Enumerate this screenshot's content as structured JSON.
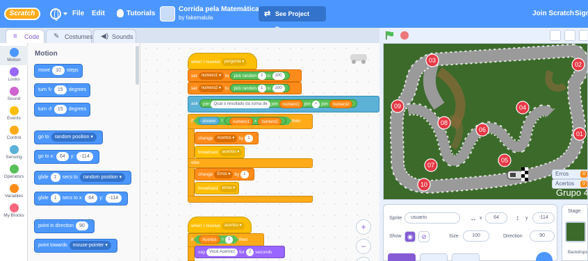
{
  "menubar": {
    "logo": "Scratch",
    "file": "File",
    "edit": "Edit",
    "tutorials": "Tutorials",
    "project_title": "Corrida pela Matemática",
    "project_author": "by fakemalula",
    "see_project": "See Project Page",
    "join": "Join Scratch",
    "sign_in": "Sign"
  },
  "tabs": {
    "code": "Code",
    "costumes": "Costumes",
    "sounds": "Sounds"
  },
  "categories": [
    {
      "label": "Motion",
      "color": "#4c97ff"
    },
    {
      "label": "Looks",
      "color": "#9966ff"
    },
    {
      "label": "Sound",
      "color": "#cf63cf"
    },
    {
      "label": "Events",
      "color": "#ffbf00"
    },
    {
      "label": "Control",
      "color": "#ffab19"
    },
    {
      "label": "Sensing",
      "color": "#5cb1d6"
    },
    {
      "label": "Operators",
      "color": "#59c059"
    },
    {
      "label": "Variables",
      "color": "#ff8c1a"
    },
    {
      "label": "My Blocks",
      "color": "#ff6680"
    }
  ],
  "palette": {
    "title": "Motion",
    "move": {
      "pre": "move",
      "val": "10",
      "post": "steps"
    },
    "turn_right": {
      "pre": "turn",
      "val": "15",
      "post": "degrees"
    },
    "turn_left": {
      "pre": "turn",
      "val": "15",
      "post": "degrees"
    },
    "goto": {
      "pre": "go to",
      "dd": "random position"
    },
    "gotoxy": {
      "pre": "go to x:",
      "x": "64",
      "ymid": "y:",
      "y": "-114"
    },
    "glide": {
      "pre": "glide",
      "val": "1",
      "mid": "secs to",
      "dd": "random position"
    },
    "glidexy": {
      "pre": "glide",
      "val": "1",
      "mid": "secs to x:",
      "x": "64",
      "ymid": "y:",
      "y": "-114"
    },
    "point_dir": {
      "pre": "point in direction",
      "val": "90"
    },
    "point_towards": {
      "pre": "point towards",
      "dd": "mouse-pointer"
    }
  },
  "script1": {
    "hat": {
      "pre": "when I receive",
      "dd": "pergunta"
    },
    "set1": {
      "pre": "set",
      "dd": "numero1",
      "mid": "to",
      "op": "pick random",
      "a": "1",
      "to": "to",
      "b": "100"
    },
    "set2": {
      "pre": "set",
      "dd": "numero2",
      "mid": "to",
      "op": "pick random",
      "a": "1",
      "to": "to",
      "b": "100"
    },
    "ask": {
      "pre": "ask",
      "j1": "join",
      "text": "Qual o resultado da soma de",
      "j2": "join",
      "v1": "numero1",
      "j3": "join",
      "plus": "+",
      "j4": "join",
      "v2": "numero2"
    },
    "if": {
      "pre": "if",
      "answer": "answer",
      "eq": "=",
      "v1": "numero1",
      "plus": "+",
      "v2": "numero2",
      "then": "then"
    },
    "change1": {
      "pre": "change",
      "dd": "Acertos",
      "mid": "by",
      "val": "1"
    },
    "broadcast1": {
      "pre": "broadcast",
      "dd": "acertou"
    },
    "else": "else",
    "change2": {
      "pre": "change",
      "dd": "Erros",
      "mid": "by",
      "val": "1"
    },
    "broadcast2": {
      "pre": "broadcast",
      "dd": "errou"
    }
  },
  "script2": {
    "hat": {
      "pre": "when I receive",
      "dd": "acertou"
    },
    "if": {
      "pre": "if",
      "v": "Acertos",
      "eq": "=",
      "val": "1",
      "then": "then"
    },
    "say": {
      "pre": "say",
      "text": "Você Acertou!",
      "mid": "for",
      "val": "2",
      "post": "seconds"
    }
  },
  "zoom": {
    "in": "+",
    "out": "−",
    "reset": "="
  },
  "stage": {
    "checkpoints": [
      "01",
      "02",
      "03",
      "04",
      "05",
      "06",
      "07",
      "08",
      "09",
      "10"
    ],
    "erros_label": "Erros",
    "erros_value": "0",
    "acertos_label": "Acertos",
    "acertos_value": "0",
    "group": "Grupo 4"
  },
  "sprite_info": {
    "sprite_label": "Sprite",
    "sprite_name": "usuario",
    "x_label": "x",
    "x": "64",
    "y_label": "y",
    "y": "-114",
    "show_label": "Show",
    "size_label": "Size",
    "size": "100",
    "direction_label": "Direction",
    "direction": "90"
  },
  "stage_panel": {
    "label": "Stage",
    "backdrops": "Backdrops"
  },
  "colors": {
    "menubar": "#4c97ff",
    "motion": "#4c97ff",
    "events": "#ffbf00",
    "control": "#ffab19",
    "operators": "#59c059",
    "variables": "#ff8c1a",
    "sensing": "#5cb1d6",
    "track_marker": "#e63946"
  }
}
